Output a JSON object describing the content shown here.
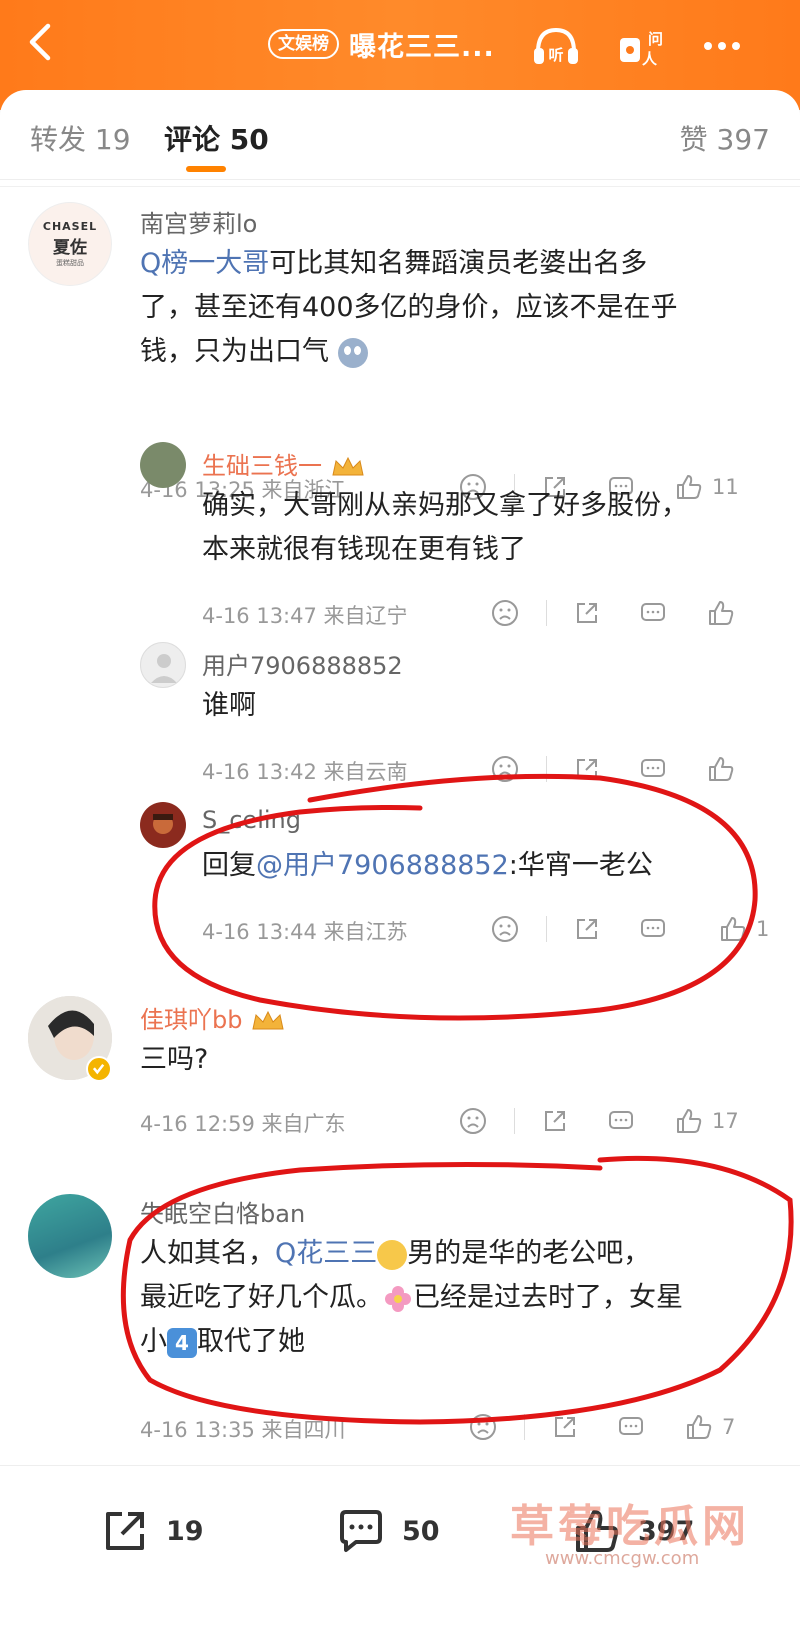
{
  "header": {
    "badge": "文娱榜",
    "title": "曝花三三...",
    "listen_icon_label": "听",
    "ask_icon_label": "问人",
    "brand_color": "#ff7a1a"
  },
  "tabs": {
    "repost_label": "转发 19",
    "comment_label": "评论 50",
    "likes_label": "赞 397"
  },
  "comments": [
    {
      "name": "南宫萝莉lo",
      "avatar_text_1": "CHASEL",
      "avatar_text_2": "夏佐",
      "avatar_text_3": "蛋糕甜品",
      "link": "Q榜一大哥",
      "text_1": "可比其知名舞蹈演员老婆出名多",
      "text_2": "了，甚至还有400多亿的身价，应该不是在乎",
      "text_3": "钱，只为出口气",
      "meta": "4-16 13:25 来自浙江",
      "likes": "11"
    },
    {
      "name": "生础三钱一",
      "text_1": "确实，大哥刚从亲妈那又拿了好多股份，",
      "text_2": "本来就很有钱现在更有钱了",
      "meta": "4-16 13:47 来自辽宁",
      "likes": ""
    },
    {
      "name": "用户7906888852",
      "text_1": "谁啊",
      "meta": "4-16 13:42 来自云南",
      "likes": ""
    },
    {
      "name": "S_celing",
      "reply_prefix": "回复",
      "reply_link": "@用户7906888852",
      "reply_text": ":华宵一老公",
      "meta": "4-16 13:44 来自江苏",
      "likes": "1"
    },
    {
      "name": "佳琪吖bb",
      "text_1": "三吗?",
      "meta": "4-16 12:59 来自广东",
      "likes": "17"
    },
    {
      "name": "失眠空白恪ban",
      "text_pre": "人如其名，",
      "link": "Q花三三",
      "text_1": "男的是华的老公吧，",
      "text_2a": "最近吃了好几个瓜。",
      "text_2b": "已经是过去时了，女星",
      "text_3a": "小",
      "text_3_box": "4",
      "text_3b": "取代了她",
      "meta": "4-16 13:35 来自四川",
      "likes": "7"
    }
  ],
  "bottom": {
    "repost_count": "19",
    "comment_count": "50",
    "like_count": "397"
  },
  "watermark": {
    "text": "草莓吃瓜网",
    "url": "www.cmcgw.com"
  }
}
